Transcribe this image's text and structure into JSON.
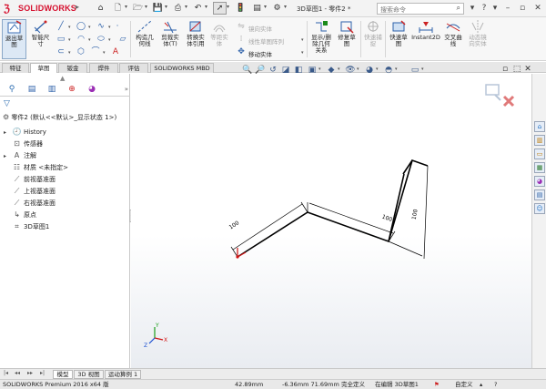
{
  "brand": {
    "logo_text": "SOLIDWORKS"
  },
  "window": {
    "doc_title": "3D草图1 - 零件2 *",
    "search_placeholder": "搜索命令"
  },
  "ribbon": {
    "buttons": [
      {
        "label": "退出草\n图"
      },
      {
        "label": "智能尺\n寸"
      },
      {
        "label": "构造几\n何线"
      },
      {
        "label": "剪裁实\n体(T)"
      },
      {
        "label": "转换实\n体引用"
      },
      {
        "label": "等距实\n体"
      },
      {
        "label": "显示/删\n除几何\n关系"
      },
      {
        "label": "修复草\n图"
      },
      {
        "label": "快速捕\n捉"
      },
      {
        "label": "快速草\n图"
      },
      {
        "label": "Instant2D"
      },
      {
        "label": "交叉曲\n线"
      },
      {
        "label": "动态镜\n向实体"
      }
    ],
    "small_items": [
      "镜向实体",
      "线性草图阵列",
      "移动实体"
    ]
  },
  "tabs": [
    "特征",
    "草图",
    "钣金",
    "焊件",
    "评估",
    "SOLIDWORKS MBD"
  ],
  "tree": {
    "root": "零件2 (默认<<默认>_显示状态 1>)",
    "items": [
      "History",
      "传感器",
      "注解",
      "材质 <未指定>",
      "前视基准面",
      "上视基准面",
      "右视基准面",
      "原点",
      "3D草图1"
    ]
  },
  "sketch": {
    "dims": [
      "100",
      "100",
      "100"
    ]
  },
  "triad": {
    "x": "X",
    "y": "Y",
    "z": "Z"
  },
  "bottom_tabs": [
    "模型",
    "3D 视图",
    "运动算例 1"
  ],
  "status": {
    "product": "SOLIDWORKS Premium 2016 x64 版",
    "x": "42.89mm",
    "yz": "-6.36mm 71.69mm",
    "state": "完全定义",
    "editing": "在编辑 3D草图1",
    "units": "自定义"
  },
  "colors": {
    "accent": "#d6112f",
    "sketch_line": "#000000",
    "origin": "#d11111",
    "triad_y": "#1b9e1b",
    "triad_z": "#1b4fd1"
  }
}
